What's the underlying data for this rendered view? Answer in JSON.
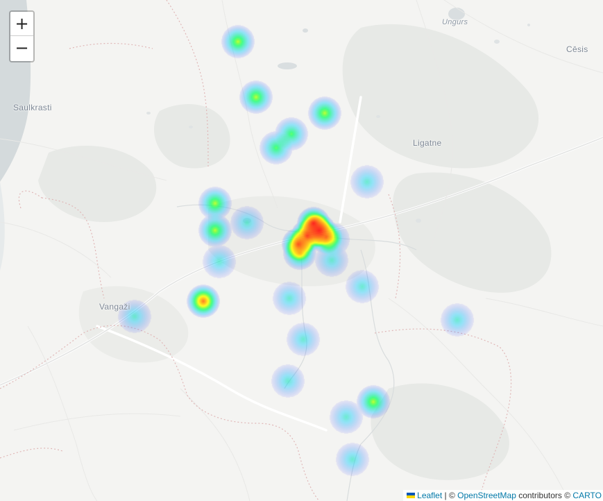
{
  "map": {
    "zoom_in_label": "+",
    "zoom_out_label": "−",
    "places": [
      {
        "key": "saulkrasti",
        "name": "Saulkrasti"
      },
      {
        "key": "ungurs",
        "name": "Ungurs"
      },
      {
        "key": "cesis",
        "name": "Cēsis"
      },
      {
        "key": "ligatne",
        "name": "Ligatne"
      },
      {
        "key": "vangazi",
        "name": "Vangaži"
      }
    ],
    "heatmap_points": [
      {
        "id": 1,
        "intensity": 0.55
      },
      {
        "id": 2,
        "intensity": 0.55
      },
      {
        "id": 3,
        "intensity": 0.55
      },
      {
        "id": 4,
        "intensity": 0.45
      },
      {
        "id": 5,
        "intensity": 0.45
      },
      {
        "id": 6,
        "intensity": 0.3
      },
      {
        "id": 7,
        "intensity": 0.55
      },
      {
        "id": 8,
        "intensity": 0.55
      },
      {
        "id": 9,
        "intensity": 0.3
      },
      {
        "id": 10,
        "intensity": 1.0
      },
      {
        "id": 11,
        "intensity": 0.85
      },
      {
        "id": 12,
        "intensity": 0.3
      },
      {
        "id": 13,
        "intensity": 0.3
      },
      {
        "id": 14,
        "intensity": 0.85
      },
      {
        "id": 15,
        "intensity": 0.3
      },
      {
        "id": 16,
        "intensity": 0.3
      },
      {
        "id": 17,
        "intensity": 0.3
      },
      {
        "id": 18,
        "intensity": 0.3
      },
      {
        "id": 19,
        "intensity": 0.3
      },
      {
        "id": 20,
        "intensity": 0.3
      },
      {
        "id": 21,
        "intensity": 0.55
      },
      {
        "id": 22,
        "intensity": 0.3
      },
      {
        "id": 23,
        "intensity": 0.3
      }
    ],
    "gradient_colors": [
      "#3b3bff",
      "#00c8ff",
      "#00ff66",
      "#ffff00",
      "#ff8800",
      "#ff0000"
    ]
  },
  "attribution": {
    "leaflet": "Leaflet",
    "sep1": " | © ",
    "osm": "OpenStreetMap",
    "contrib": " contributors © ",
    "carto": "CARTO"
  }
}
